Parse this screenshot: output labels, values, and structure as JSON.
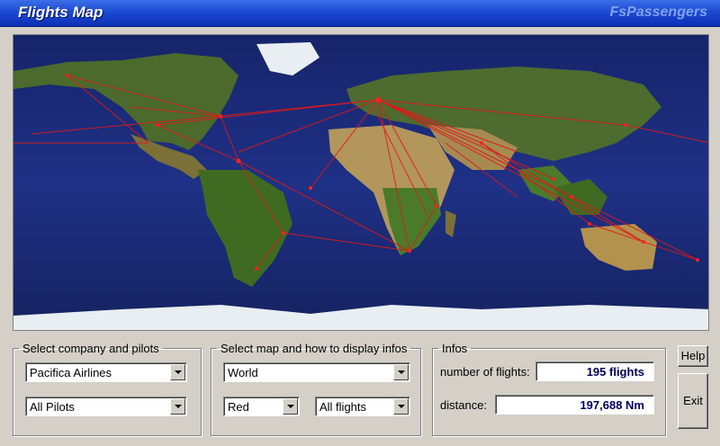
{
  "window": {
    "title": "Flights Map",
    "brand": "FsPassengers"
  },
  "map": {
    "route_color": "#e01818"
  },
  "company_group": {
    "legend": "Select company and pilots",
    "company": "Pacifica Airlines",
    "pilots": "All Pilots"
  },
  "display_group": {
    "legend": "Select map and how to display infos",
    "map": "World",
    "color": "Red",
    "filter": "All flights"
  },
  "infos": {
    "legend": "Infos",
    "flights_label": "number of flights:",
    "flights_value": "195 flights",
    "distance_label": "distance:",
    "distance_value": "197,688 Nm"
  },
  "buttons": {
    "help": "Help",
    "exit": "Exit"
  }
}
